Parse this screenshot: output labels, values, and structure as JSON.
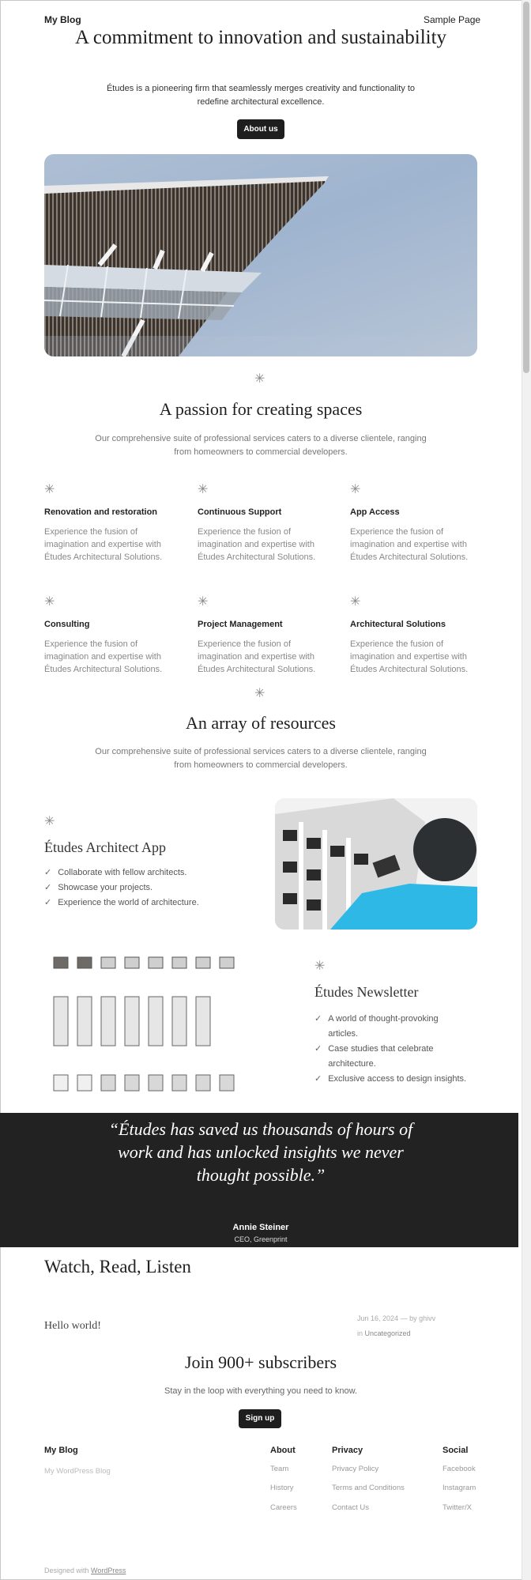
{
  "header": {
    "site_title": "My Blog",
    "nav_link": "Sample Page"
  },
  "hero": {
    "heading": "A commitment to innovation and sustainability",
    "text": "Études is a pioneering firm that seamlessly merges creativity and functionality to redefine architectural excellence.",
    "button": "About us"
  },
  "services": {
    "heading": "A passion for creating spaces",
    "text": "Our comprehensive suite of professional services caters to a diverse clientele, ranging from homeowners to commercial developers.",
    "items": [
      {
        "title": "Renovation and restoration",
        "desc": "Experience the fusion of imagination and expertise with Études Architectural Solutions."
      },
      {
        "title": "Continuous Support",
        "desc": "Experience the fusion of imagination and expertise with Études Architectural Solutions."
      },
      {
        "title": "App Access",
        "desc": "Experience the fusion of imagination and expertise with Études Architectural Solutions."
      },
      {
        "title": "Consulting",
        "desc": "Experience the fusion of imagination and expertise with Études Architectural Solutions."
      },
      {
        "title": "Project Management",
        "desc": "Experience the fusion of imagination and expertise with Études Architectural Solutions."
      },
      {
        "title": "Architectural Solutions",
        "desc": "Experience the fusion of imagination and expertise with Études Architectural Solutions."
      }
    ]
  },
  "resources": {
    "heading": "An array of resources",
    "text": "Our comprehensive suite of professional services caters to a diverse clientele, ranging from homeowners to commercial developers."
  },
  "app": {
    "heading": "Études Architect App",
    "items": [
      "Collaborate with fellow architects.",
      "Showcase your projects.",
      "Experience the world of architecture."
    ]
  },
  "newsletter": {
    "heading": "Études Newsletter",
    "items": [
      "A world of thought-provoking articles.",
      "Case studies that celebrate architecture.",
      "Exclusive access to design insights."
    ]
  },
  "testimonial": {
    "quote": "“Études has saved us thousands of hours of work and has unlocked insights we never thought possible.”",
    "name": "Annie Steiner",
    "role": "CEO, Greenprint"
  },
  "posts": {
    "heading": "Watch, Read, Listen",
    "post_title": "Hello world!",
    "date": "Jun 16, 2024",
    "by": "— by",
    "author": "ghivv",
    "in": "in",
    "category": "Uncategorized"
  },
  "subscribe": {
    "heading": "Join 900+ subscribers",
    "text": "Stay in the loop with everything you need to know.",
    "button": "Sign up"
  },
  "footer": {
    "title": "My Blog",
    "tagline": "My WordPress Blog",
    "columns": [
      {
        "heading": "About",
        "links": [
          "Team",
          "History",
          "Careers"
        ]
      },
      {
        "heading": "Privacy",
        "links": [
          "Privacy Policy",
          "Terms and Conditions",
          "Contact Us"
        ]
      },
      {
        "heading": "Social",
        "links": [
          "Facebook",
          "Instagram",
          "Twitter/X"
        ]
      }
    ],
    "credit_prefix": "Designed with",
    "credit_link": "WordPress"
  },
  "icons": {
    "star": "asterisk-icon",
    "check": "check-icon"
  },
  "colors": {
    "dark": "#1e1e1e",
    "muted": "#888888",
    "sky": "#9fb4cf"
  }
}
